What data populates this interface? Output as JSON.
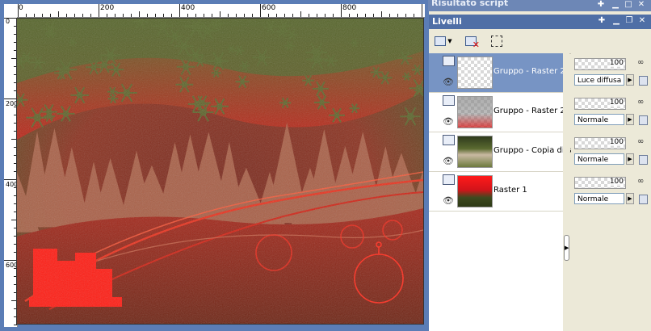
{
  "script_panel": {
    "title": "Risultato script"
  },
  "layers_panel": {
    "title": "Livelli",
    "toolbar": [
      {
        "icon": "new-layer-icon"
      },
      {
        "icon": "delete-layer-icon"
      },
      {
        "icon": "edit-selection-icon"
      }
    ],
    "layers": [
      {
        "name": "Gruppo - Raster 2",
        "selected": true,
        "thumb": "transparent",
        "opacity": "100",
        "blend": "Luce diffusa"
      },
      {
        "name": "Gruppo - Raster 2",
        "selected": false,
        "thumb": "grey-red",
        "opacity": "100",
        "blend": "Normale"
      },
      {
        "name": "Gruppo - Copia diRas",
        "selected": false,
        "thumb": "green-trees",
        "opacity": "100",
        "blend": "Normale"
      },
      {
        "name": "Raster 1",
        "selected": false,
        "thumb": "red-green",
        "opacity": "100",
        "blend": "Normale"
      }
    ]
  },
  "rulers": {
    "horizontal_labels": [
      "0",
      "200",
      "400",
      "600",
      "800"
    ],
    "vertical_labels": [
      "0",
      "200",
      "400",
      "600"
    ]
  },
  "colors": {
    "accent": "#4f6fa6",
    "selected_row": "#7794c4",
    "art_red": "#c8211a",
    "art_green": "#4e5a2a"
  }
}
